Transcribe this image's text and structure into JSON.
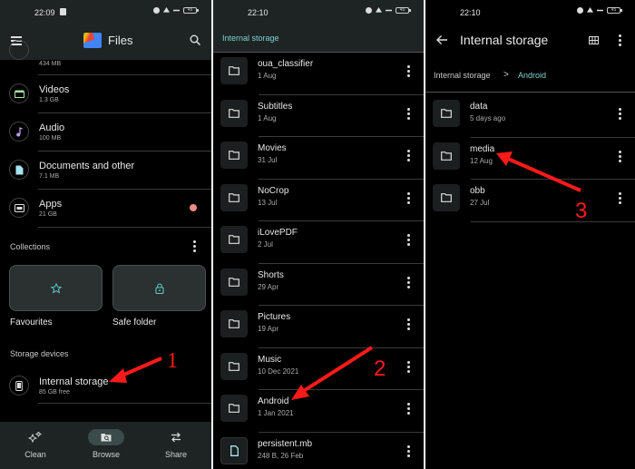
{
  "panel1": {
    "status": {
      "time": "22:09",
      "battery": "45"
    },
    "app_title": "Files",
    "categories": [
      {
        "name": "",
        "size": "434 MB",
        "icon": "images-icon"
      },
      {
        "name": "Videos",
        "size": "1.3 GB",
        "icon": "video-icon"
      },
      {
        "name": "Audio",
        "size": "100 MB",
        "icon": "music-note-icon"
      },
      {
        "name": "Documents and other",
        "size": "7.1 MB",
        "icon": "document-icon"
      },
      {
        "name": "Apps",
        "size": "21 GB",
        "icon": "android-icon"
      }
    ],
    "collections_label": "Collections",
    "collections": [
      {
        "label": "Favourites",
        "icon": "star-icon"
      },
      {
        "label": "Safe folder",
        "icon": "lock-icon"
      }
    ],
    "storage_devices_label": "Storage devices",
    "storage": {
      "name": "Internal storage",
      "free": "85 GB free"
    },
    "nav": [
      {
        "label": "Clean",
        "icon": "sparkle-icon",
        "active": false
      },
      {
        "label": "Browse",
        "icon": "folder-search-icon",
        "active": true
      },
      {
        "label": "Share",
        "icon": "swap-arrows-icon",
        "active": false
      }
    ],
    "annotation_number": "1"
  },
  "panel2": {
    "status": {
      "time": "22:10",
      "battery": "45"
    },
    "breadcrumb": "Internal storage",
    "items": [
      {
        "name": "oua_classifier",
        "meta": "1 Aug",
        "type": "folder"
      },
      {
        "name": "Subtitles",
        "meta": "1 Aug",
        "type": "folder"
      },
      {
        "name": "Movies",
        "meta": "31 Jul",
        "type": "folder"
      },
      {
        "name": "NoCrop",
        "meta": "13 Jul",
        "type": "folder"
      },
      {
        "name": "iLovePDF",
        "meta": "2 Jul",
        "type": "folder"
      },
      {
        "name": "Shorts",
        "meta": "29 Apr",
        "type": "folder"
      },
      {
        "name": "Pictures",
        "meta": "19 Apr",
        "type": "folder"
      },
      {
        "name": "Music",
        "meta": "10 Dec 2021",
        "type": "folder"
      },
      {
        "name": "Android",
        "meta": "1 Jan 2021",
        "type": "folder"
      },
      {
        "name": "persistent.mb",
        "meta": "248 B, 26 Feb",
        "type": "file"
      }
    ],
    "annotation_number": "2"
  },
  "panel3": {
    "status": {
      "time": "22:10",
      "battery": "45"
    },
    "title": "Internal storage",
    "breadcrumb": {
      "root": "Internal storage",
      "separator": ">",
      "current": "Android"
    },
    "items": [
      {
        "name": "data",
        "meta": "5 days ago"
      },
      {
        "name": "media",
        "meta": "12 Aug"
      },
      {
        "name": "obb",
        "meta": "27 Jul"
      }
    ],
    "annotation_number": "3"
  },
  "colors": {
    "accent_teal": "#7fd3d0",
    "annotation_red": "#ff1a1a",
    "bar_bg": "#1e2424",
    "apps_dot": "#f28b82"
  }
}
